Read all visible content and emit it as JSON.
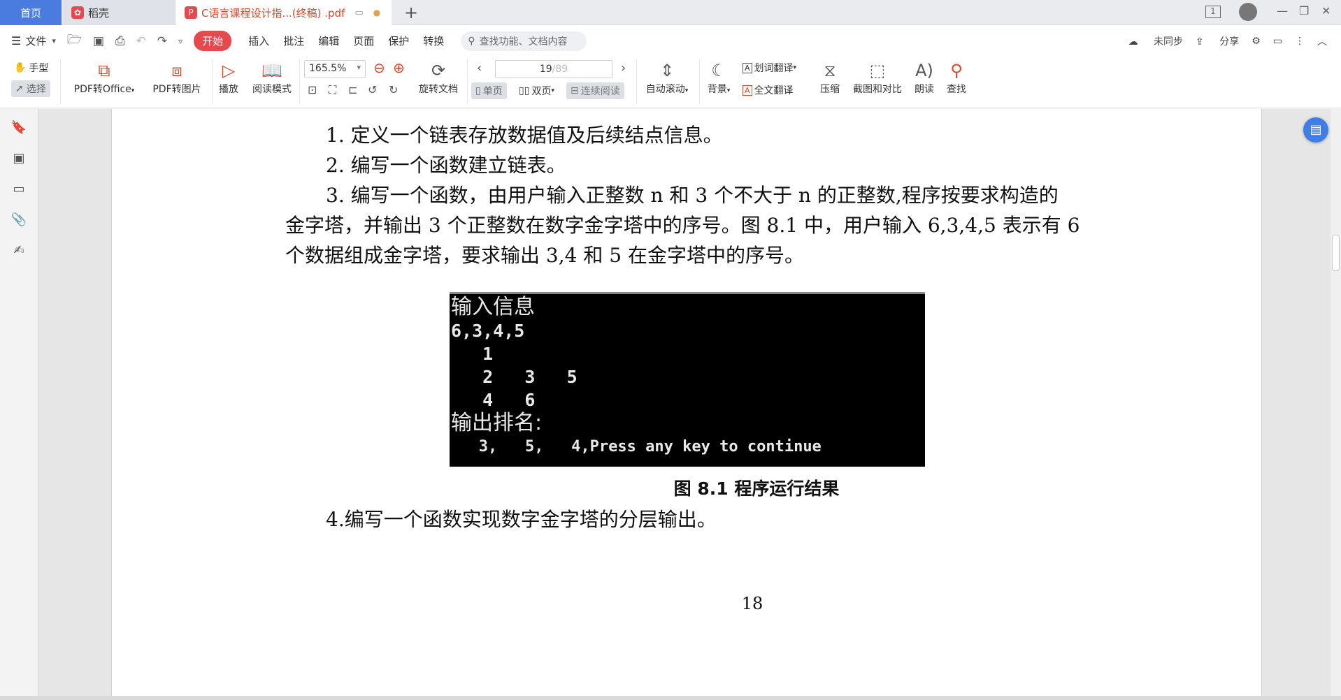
{
  "tabs": {
    "home": "首页",
    "daoke": "稻壳",
    "pdf": "C语言课程设计指...(终稿) .pdf",
    "add": "+"
  },
  "menu": {
    "file": "文件",
    "start": "开始",
    "insert": "插入",
    "annotate": "批注",
    "edit": "编辑",
    "page": "页面",
    "protect": "保护",
    "convert": "转换",
    "search_placeholder": "查找功能、文档内容",
    "sync": "未同步",
    "share": "分享"
  },
  "toolbar": {
    "hand": "手型",
    "select": "选择",
    "pdf_to_office": "PDF转Office",
    "pdf_to_image": "PDF转图片",
    "play": "播放",
    "read_mode": "阅读模式",
    "zoom": "165.5%",
    "rotate_doc": "旋转文档",
    "page_current": "19",
    "page_total": "/89",
    "single_page": "单页",
    "double_page": "双页",
    "continuous": "连续阅读",
    "auto_scroll": "自动滚动",
    "background": "背景",
    "word_translate": "划词翻译",
    "full_translate": "全文翻译",
    "compress": "压缩",
    "screenshot_compare": "截图和对比",
    "read_aloud": "朗读",
    "find": "查找"
  },
  "document": {
    "p1": "1.  定义一个链表存放数据值及后续结点信息。",
    "p2": "2.  编写一个函数建立链表。",
    "p3_line1": "3.  编写一个函数，由用户输入正整数 n 和 3 个不大于 n 的正整数,程序按要求构造的",
    "p3_line2": "金字塔，并输出 3 个正整数在数字金字塔中的序号。图 8.1 中，用户输入 6,3,4,5 表示有 6",
    "p3_line3": "个数据组成金字塔，要求输出 3,4 和 5 在金字塔中的序号。",
    "console_lines": [
      "输入信息",
      "6,3,4,5",
      "   1",
      "   2   3   5",
      "   4   6",
      "输出排名:",
      "   3,   5,   4,Press any key to continue"
    ],
    "caption": "图 8.1  程序运行结果",
    "p4": "4.编写一个函数实现数字金字塔的分层输出。",
    "page_number": "18"
  }
}
